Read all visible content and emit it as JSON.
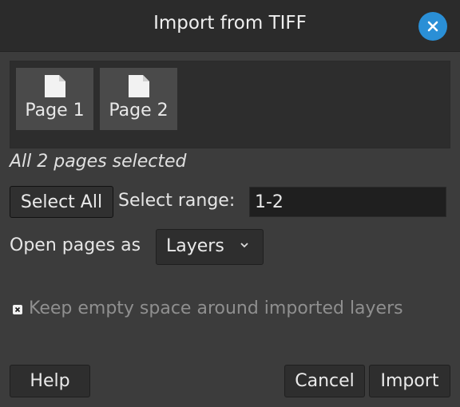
{
  "dialog": {
    "title": "Import from TIFF",
    "close_icon": "close-icon"
  },
  "pages": [
    {
      "label": "Page 1",
      "icon": "document-icon"
    },
    {
      "label": "Page 2",
      "icon": "document-icon"
    }
  ],
  "status": "All 2 pages selected",
  "selection": {
    "select_all_label": "Select All",
    "range_label": "Select range:",
    "range_value": "1-2"
  },
  "open_as": {
    "label": "Open pages as",
    "selected": "Layers"
  },
  "keep_space": {
    "label": "Keep empty space around imported layers",
    "checked": false
  },
  "buttons": {
    "help": "Help",
    "cancel": "Cancel",
    "import": "Import"
  },
  "colors": {
    "accent": "#2a8fd6",
    "background": "#3c3c3c",
    "titlebar": "#2b2b2b"
  }
}
